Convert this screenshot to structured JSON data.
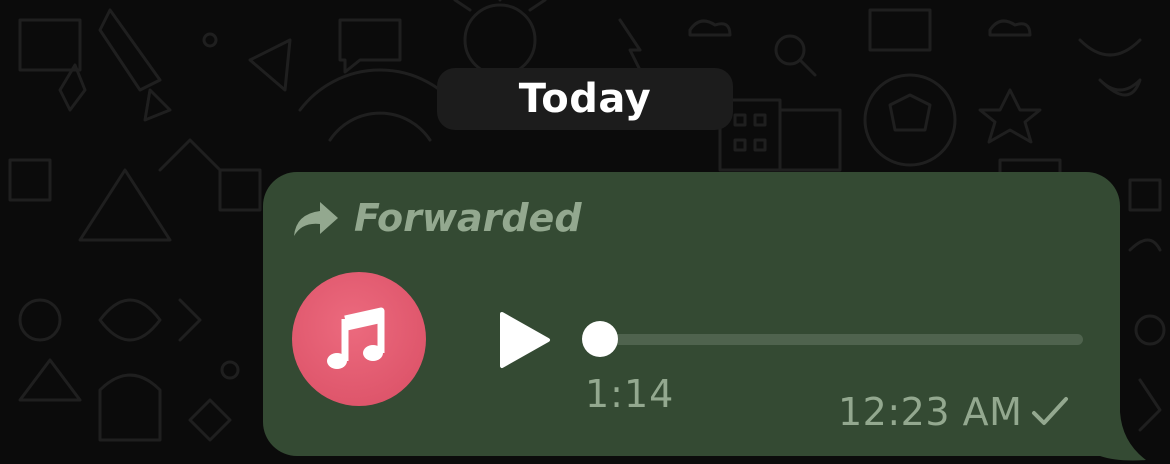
{
  "date_separator": {
    "label": "Today"
  },
  "message": {
    "forwarded_label": "Forwarded",
    "forwarded_icon": "forward-arrow-icon",
    "audio": {
      "avatar_icon": "music-note-icon",
      "avatar_color": "#e05a6e",
      "play_icon": "play-icon",
      "progress": 0,
      "duration": "1:14"
    },
    "timestamp": "12:23 AM",
    "status_icon": "single-check-icon"
  },
  "colors": {
    "background": "#0b0b0b",
    "bubble": "#344a33",
    "muted_text": "#93a88f",
    "pill": "#1c1c1c",
    "track": "#4f634e"
  }
}
